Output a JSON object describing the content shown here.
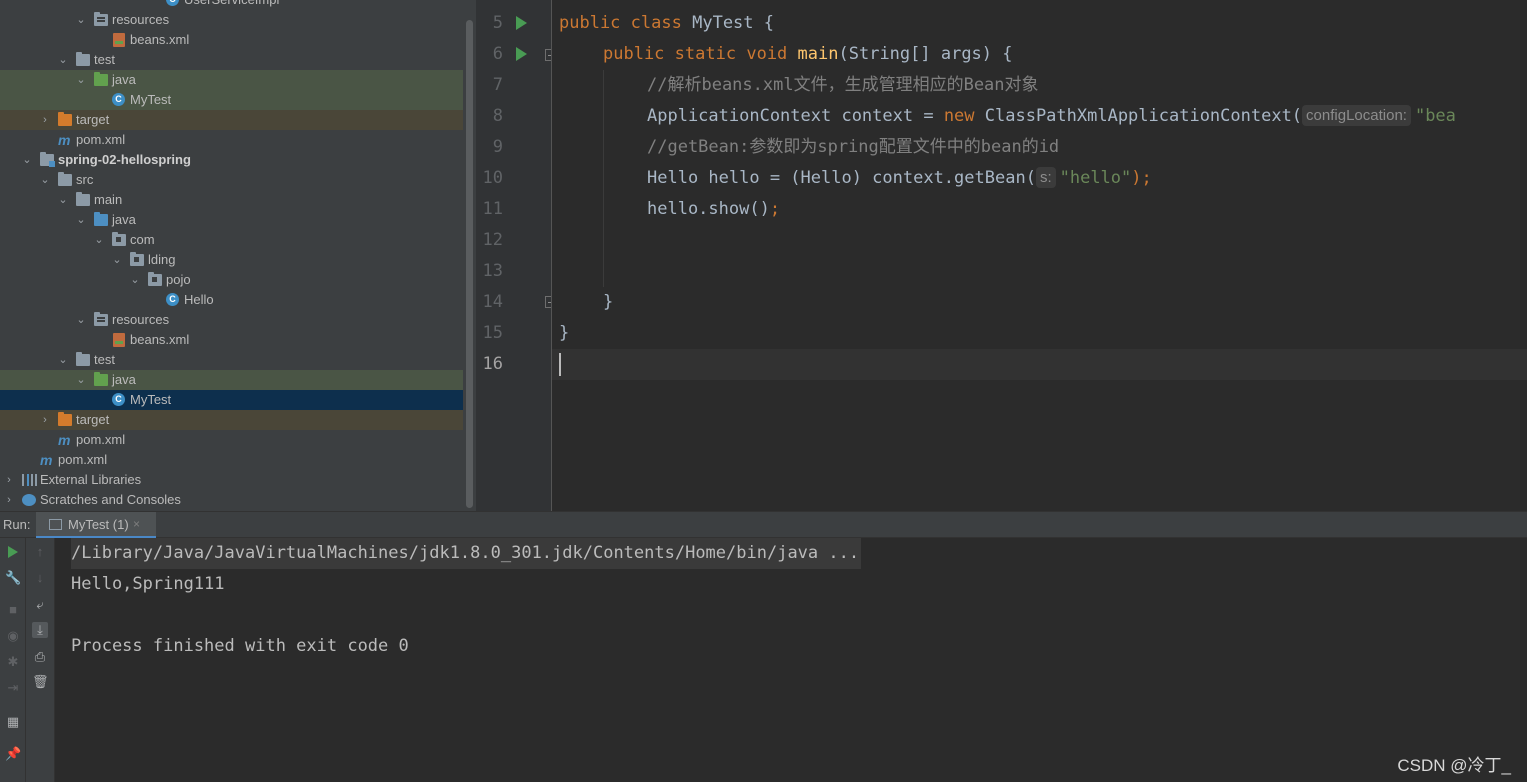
{
  "project_tree": {
    "rows": [
      {
        "label": "UserServiceImpl",
        "icon": "class-icon"
      },
      {
        "label": "resources",
        "icon": "resources-folder-icon"
      },
      {
        "label": "beans.xml",
        "icon": "xml-file-icon"
      },
      {
        "label": "test",
        "icon": "folder-icon"
      },
      {
        "label": "java",
        "icon": "test-folder-icon"
      },
      {
        "label": "MyTest",
        "icon": "class-icon"
      },
      {
        "label": "target",
        "icon": "excluded-folder-icon"
      },
      {
        "label": "pom.xml",
        "icon": "maven-icon"
      },
      {
        "label": "spring-02-hellospring",
        "icon": "module-icon"
      },
      {
        "label": "src",
        "icon": "folder-icon"
      },
      {
        "label": "main",
        "icon": "folder-icon"
      },
      {
        "label": "java",
        "icon": "source-folder-icon"
      },
      {
        "label": "com",
        "icon": "package-icon"
      },
      {
        "label": "lding",
        "icon": "package-icon"
      },
      {
        "label": "pojo",
        "icon": "package-icon"
      },
      {
        "label": "Hello",
        "icon": "class-icon"
      },
      {
        "label": "resources",
        "icon": "resources-folder-icon"
      },
      {
        "label": "beans.xml",
        "icon": "xml-file-icon"
      },
      {
        "label": "test",
        "icon": "folder-icon"
      },
      {
        "label": "java",
        "icon": "test-folder-icon"
      },
      {
        "label": "MyTest",
        "icon": "class-icon"
      },
      {
        "label": "target",
        "icon": "excluded-folder-icon"
      },
      {
        "label": "pom.xml",
        "icon": "maven-icon"
      },
      {
        "label": "pom.xml",
        "icon": "maven-icon"
      },
      {
        "label": "External Libraries",
        "icon": "libraries-icon"
      },
      {
        "label": "Scratches and Consoles",
        "icon": "scratches-icon"
      }
    ],
    "maven_glyph": "m",
    "class_glyph": "C"
  },
  "editor": {
    "line_numbers": [
      "5",
      "6",
      "7",
      "8",
      "9",
      "10",
      "11",
      "12",
      "13",
      "14",
      "15",
      "16"
    ],
    "current_line": "16",
    "code": {
      "l5_kw1": "public",
      "l5_kw2": "class",
      "l5_name": "MyTest",
      "l5_brace": "{",
      "l6_kw1": "public",
      "l6_kw2": "static",
      "l6_kw3": "void",
      "l6_fn": "main",
      "l6_params": "(String[] args) {",
      "l7_comment": "//解析beans.xml文件，生成管理相应的Bean对象",
      "l8_left": "ApplicationContext context = ",
      "l8_kw": "new",
      "l8_call": " ClassPathXmlApplicationContext(",
      "l8_hint": "configLocation:",
      "l8_str": "\"bea",
      "l9_comment": "//getBean:参数即为spring配置文件中的bean的id",
      "l10_left": "Hello hello = (Hello) context.getBean(",
      "l10_hint": "s:",
      "l10_str": "\"hello\"",
      "l10_end": ");",
      "l11_left": "hello.show()",
      "l11_end": ";",
      "l14_brace": "}",
      "l15_brace": "}"
    }
  },
  "run_panel": {
    "label": "Run:",
    "tab_label": "MyTest (1)",
    "tab_close": "×",
    "console_lines": [
      "/Library/Java/JavaVirtualMachines/jdk1.8.0_301.jdk/Contents/Home/bin/java ...",
      "Hello,Spring111",
      "Process finished with exit code 0"
    ]
  },
  "watermark": "CSDN @冷丁_",
  "colors": {
    "keyword": "#cc7832",
    "function": "#ffc66d",
    "comment": "#808080",
    "string": "#6a8759",
    "run_green": "#499c54"
  }
}
